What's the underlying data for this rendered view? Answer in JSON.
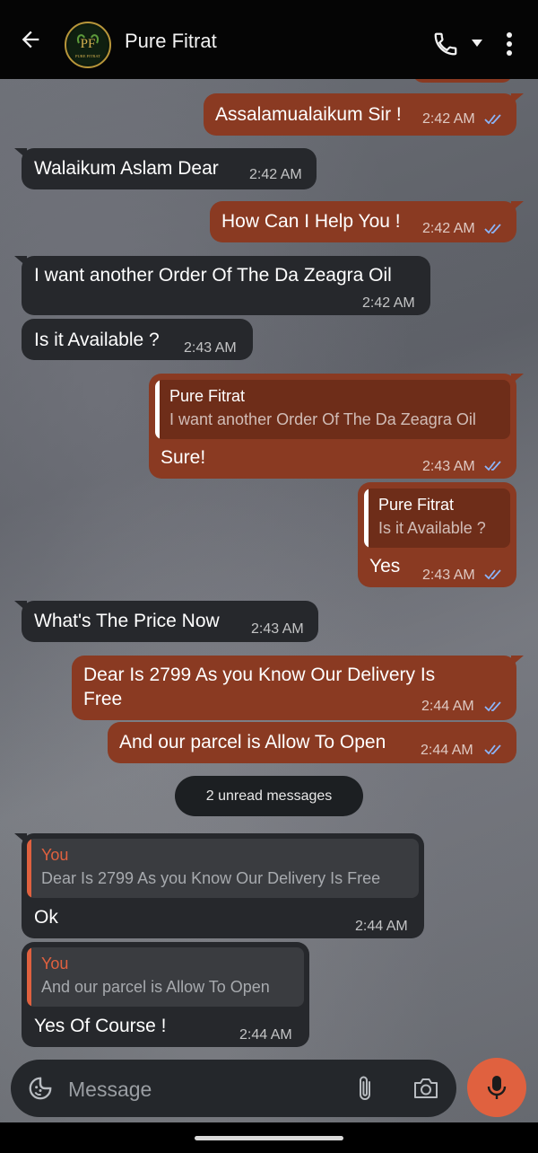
{
  "header": {
    "contact_name": "Pure Fitrat",
    "avatar_monogram": "PF",
    "avatar_caption": "PURE FITRAT"
  },
  "messages": [
    {
      "dir": "out",
      "text": "Assalamualaikum Sir !",
      "time": "2:42 AM",
      "read": true
    },
    {
      "dir": "in",
      "text": "Walaikum Aslam Dear",
      "time": "2:42 AM"
    },
    {
      "dir": "out",
      "text": "How Can I Help You !",
      "time": "2:42 AM",
      "read": true
    },
    {
      "dir": "in",
      "text": "I want another Order Of The Da Zeagra Oil",
      "time": "2:42 AM"
    },
    {
      "dir": "in",
      "text": "Is it Available ?",
      "time": "2:43 AM"
    },
    {
      "dir": "out",
      "quote_name": "Pure Fitrat",
      "quote_text": "I want another Order Of The Da Zeagra Oil",
      "text": "Sure!",
      "time": "2:43 AM",
      "read": true
    },
    {
      "dir": "out",
      "quote_name": "Pure Fitrat",
      "quote_text": "Is it Available ?",
      "text": "Yes",
      "time": "2:43 AM",
      "read": true
    },
    {
      "dir": "in",
      "text": "What's The Price Now",
      "time": "2:43 AM"
    },
    {
      "dir": "out",
      "text_line1": "Dear Is 2799 As you Know Our Delivery Is",
      "text_line2": "Free",
      "time": "2:44 AM",
      "read": true
    },
    {
      "dir": "out",
      "text": "And our parcel is Allow To Open",
      "time": "2:44 AM",
      "read": true
    },
    {
      "dir": "in",
      "quote_name": "You",
      "quote_text": "Dear Is 2799 As you Know Our Delivery Is Free",
      "text": "Ok",
      "time": "2:44 AM"
    },
    {
      "dir": "in",
      "quote_name": "You",
      "quote_text": "And our parcel is Allow To Open",
      "text": "Yes Of Course !",
      "time": "2:44 AM"
    }
  ],
  "unread_banner": "2 unread messages",
  "composer": {
    "placeholder": "Message"
  },
  "colors": {
    "outgoing_bubble": "#8a3a22",
    "incoming_bubble": "#26282c",
    "read_ticks": "#8ab4f8",
    "mic_button": "#e0613f",
    "quote_bar_outgoing": "#ffffff",
    "quote_bar_incoming": "#e0613f"
  },
  "icons": [
    "back-arrow-icon",
    "phone-icon",
    "chevron-down-icon",
    "more-vert-icon",
    "emoji-icon",
    "attach-icon",
    "camera-icon",
    "mic-icon",
    "double-check-icon"
  ]
}
